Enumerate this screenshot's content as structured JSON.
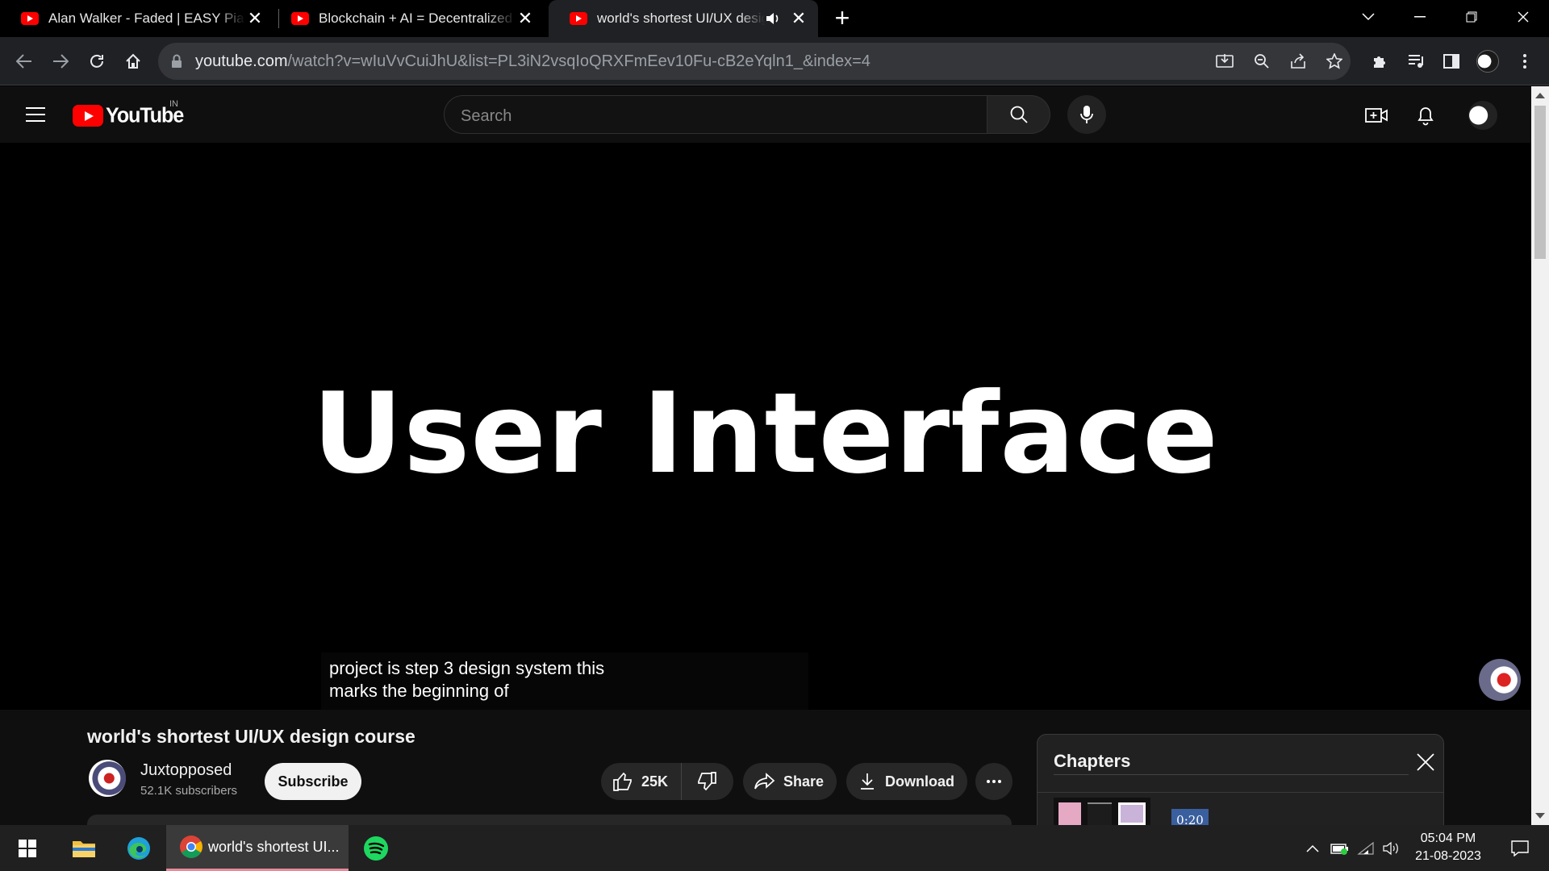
{
  "browser": {
    "tabs": [
      {
        "title": "Alan Walker - Faded | EASY Piano",
        "active": false
      },
      {
        "title": "Blockchain + AI = Decentralized AI",
        "active": false
      },
      {
        "title": "world's shortest UI/UX design course",
        "active": true,
        "audio": true
      }
    ],
    "url_host": "youtube.com",
    "url_path": "/watch?v=wIuVvCuiJhU&list=PL3iN2vsqIoQRXFmEev10Fu-cB2eYqln1_&index=4"
  },
  "youtube": {
    "logo_text": "YouTube",
    "country_code": "IN",
    "search_placeholder": "Search"
  },
  "player": {
    "slide_text": "User Interface",
    "caption_line1": "project is step 3 design system this",
    "caption_line2": "marks the beginning of"
  },
  "video": {
    "title": "world's shortest UI/UX design course",
    "channel_name": "Juxtopposed",
    "subscribers": "52.1K subscribers",
    "subscribe_label": "Subscribe",
    "likes": "25K",
    "share_label": "Share",
    "download_label": "Download"
  },
  "chapters": {
    "title": "Chapters",
    "first_timestamp": "0:20"
  },
  "taskbar": {
    "chrome_label": "world's shortest UI...",
    "time": "05:04 PM",
    "date": "21-08-2023"
  },
  "colors": {
    "youtube_red": "#ff0000",
    "youtube_bg": "#0f0f0f",
    "chrome_toolbar": "#202124",
    "taskbar": "#202020"
  }
}
